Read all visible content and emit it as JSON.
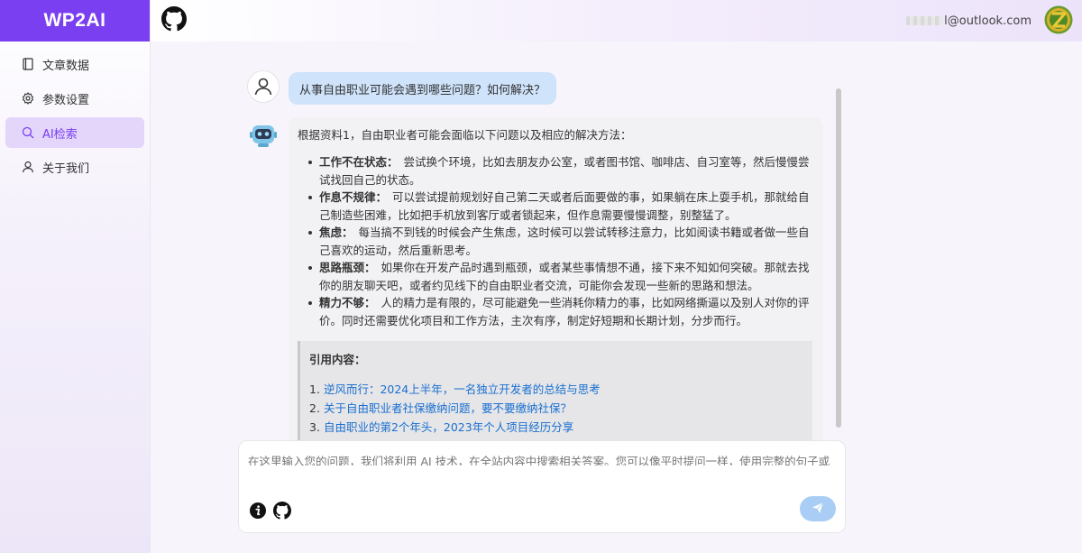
{
  "brand": {
    "logo_text": "WP2AI",
    "accent": "#7a3ff0"
  },
  "sidebar": {
    "items": [
      {
        "label": "文章数据",
        "icon": "book-icon",
        "active": false
      },
      {
        "label": "参数设置",
        "icon": "gear-icon",
        "active": false
      },
      {
        "label": "AI检索",
        "icon": "search-icon",
        "active": true
      },
      {
        "label": "关于我们",
        "icon": "user-icon",
        "active": false
      }
    ]
  },
  "header": {
    "github_icon": "github-icon",
    "email_visible": "l@outlook.com",
    "avatar_icon": "z-avatar-icon"
  },
  "chat": {
    "user_message": "从事自由职业可能会遇到哪些问题？如何解决？",
    "bot_intro": "根据资料1，自由职业者可能会面临以下问题以及相应的解决方法：",
    "bot_points": [
      {
        "title": "工作不在状态：",
        "text": "尝试换个环境，比如去朋友办公室，或者图书馆、咖啡店、自习室等，然后慢慢尝试找回自己的状态。"
      },
      {
        "title": "作息不规律：",
        "text": "可以尝试提前规划好自己第二天或者后面要做的事，如果躺在床上耍手机，那就给自己制造些困难，比如把手机放到客厅或者锁起来，但作息需要慢慢调整，别整猛了。"
      },
      {
        "title": "焦虑：",
        "text": "每当搞不到钱的时候会产生焦虑，这时候可以尝试转移注意力，比如阅读书籍或者做一些自己喜欢的运动，然后重新思考。"
      },
      {
        "title": "思路瓶颈：",
        "text": "如果你在开发产品时遇到瓶颈，或者某些事情想不通，接下来不知如何突破。那就去找你的朋友聊天吧，或者约见线下的自由职业者交流，可能你会发现一些新的思路和想法。"
      },
      {
        "title": "精力不够：",
        "text": "人的精力是有限的，尽可能避免一些消耗你精力的事，比如网络撕逼以及别人对你的评价。同时还需要优化项目和工作方法，主次有序，制定好短期和长期计划，分步而行。"
      }
    ],
    "quote_title": "引用内容：",
    "references": [
      {
        "num": "1.",
        "title": "逆风而行：2024上半年，一名独立开发者的总结与思考"
      },
      {
        "num": "2.",
        "title": "关于自由职业者社保缴纳问题，要不要缴纳社保？"
      },
      {
        "num": "3.",
        "title": "自由职业的第2个年头，2023年个人项目经历分享"
      }
    ]
  },
  "input": {
    "placeholder": "在这里输入您的问题，我们将利用 AI 技术，在全站内容中搜索相关答案。您可以像平时提问一样，使用完整的句子或短语。",
    "send_icon": "send-icon"
  }
}
